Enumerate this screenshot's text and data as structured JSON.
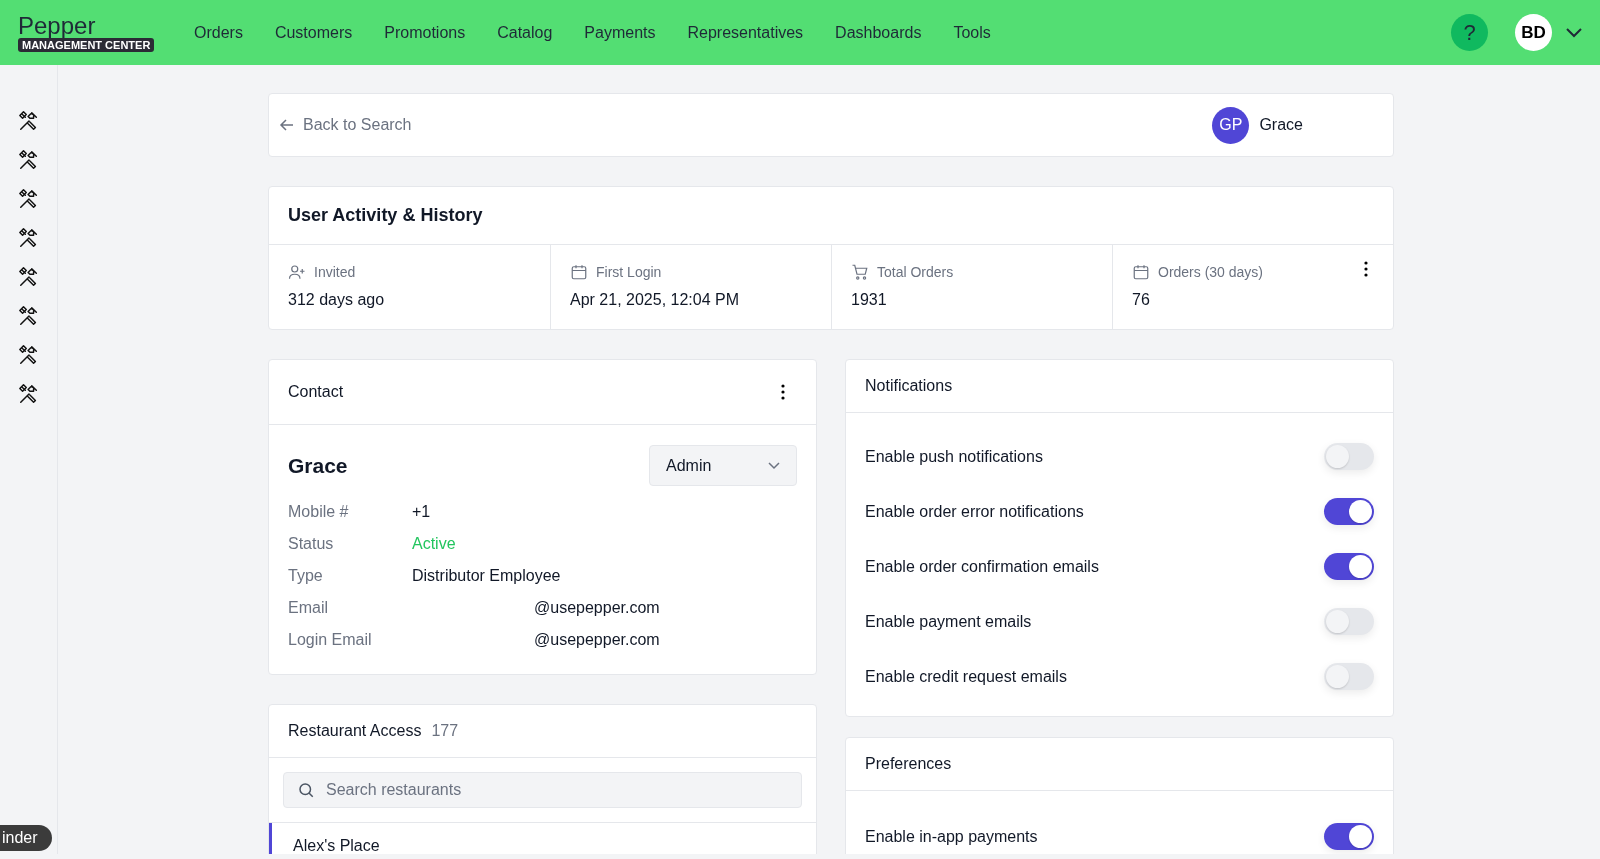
{
  "header": {
    "logo": "Pepper",
    "logo_badge": "MANAGEMENT CENTER",
    "nav": [
      {
        "label": "Orders",
        "selected": false
      },
      {
        "label": "Customers",
        "selected": false
      },
      {
        "label": "Promotions",
        "selected": false
      },
      {
        "label": "Catalog",
        "selected": false
      },
      {
        "label": "Payments",
        "selected": false
      },
      {
        "label": "Representatives",
        "selected": false
      },
      {
        "label": "Dashboards",
        "selected": false
      },
      {
        "label": "Tools",
        "selected": false
      }
    ],
    "help": "?",
    "user_initials": "BD"
  },
  "back": {
    "label": "Back to Search",
    "user_initials": "GP",
    "user_name": "Grace"
  },
  "activity": {
    "title": "User Activity & History",
    "stats": [
      {
        "kind": "invited",
        "label": "Invited",
        "value": "312 days ago"
      },
      {
        "kind": "calendar",
        "label": "First Login",
        "value": "Apr 21, 2025, 12:04 PM"
      },
      {
        "kind": "cart",
        "label": "Total Orders",
        "value": "1931"
      },
      {
        "kind": "calendar",
        "label": "Orders (30 days)",
        "value": "76"
      }
    ]
  },
  "contact": {
    "title": "Contact",
    "name": "Grace",
    "role": "Admin",
    "fields": [
      {
        "label": "Mobile #",
        "value": "+1",
        "kind": "plain"
      },
      {
        "label": "Status",
        "value": "Active",
        "kind": "status"
      },
      {
        "label": "Type",
        "value": "Distributor Employee",
        "kind": "plain"
      },
      {
        "label": "Email",
        "value": "@usepepper.com",
        "kind": "email"
      },
      {
        "label": "Login Email",
        "value": "@usepepper.com",
        "kind": "email"
      }
    ]
  },
  "restaurant_access": {
    "title": "Restaurant Access",
    "count": "177",
    "search_placeholder": "Search restaurants",
    "rows": [
      {
        "name": "Alex's Place",
        "selected": true
      }
    ]
  },
  "notifications": {
    "title": "Notifications",
    "items": [
      {
        "label": "Enable push notifications",
        "on": false
      },
      {
        "label": "Enable order error notifications",
        "on": true
      },
      {
        "label": "Enable order confirmation emails",
        "on": true
      },
      {
        "label": "Enable payment emails",
        "on": false
      },
      {
        "label": "Enable credit request emails",
        "on": false
      }
    ]
  },
  "preferences": {
    "title": "Preferences",
    "items": [
      {
        "label": "Enable in-app payments",
        "on": true
      }
    ]
  },
  "dock_tooltip": "inder"
}
